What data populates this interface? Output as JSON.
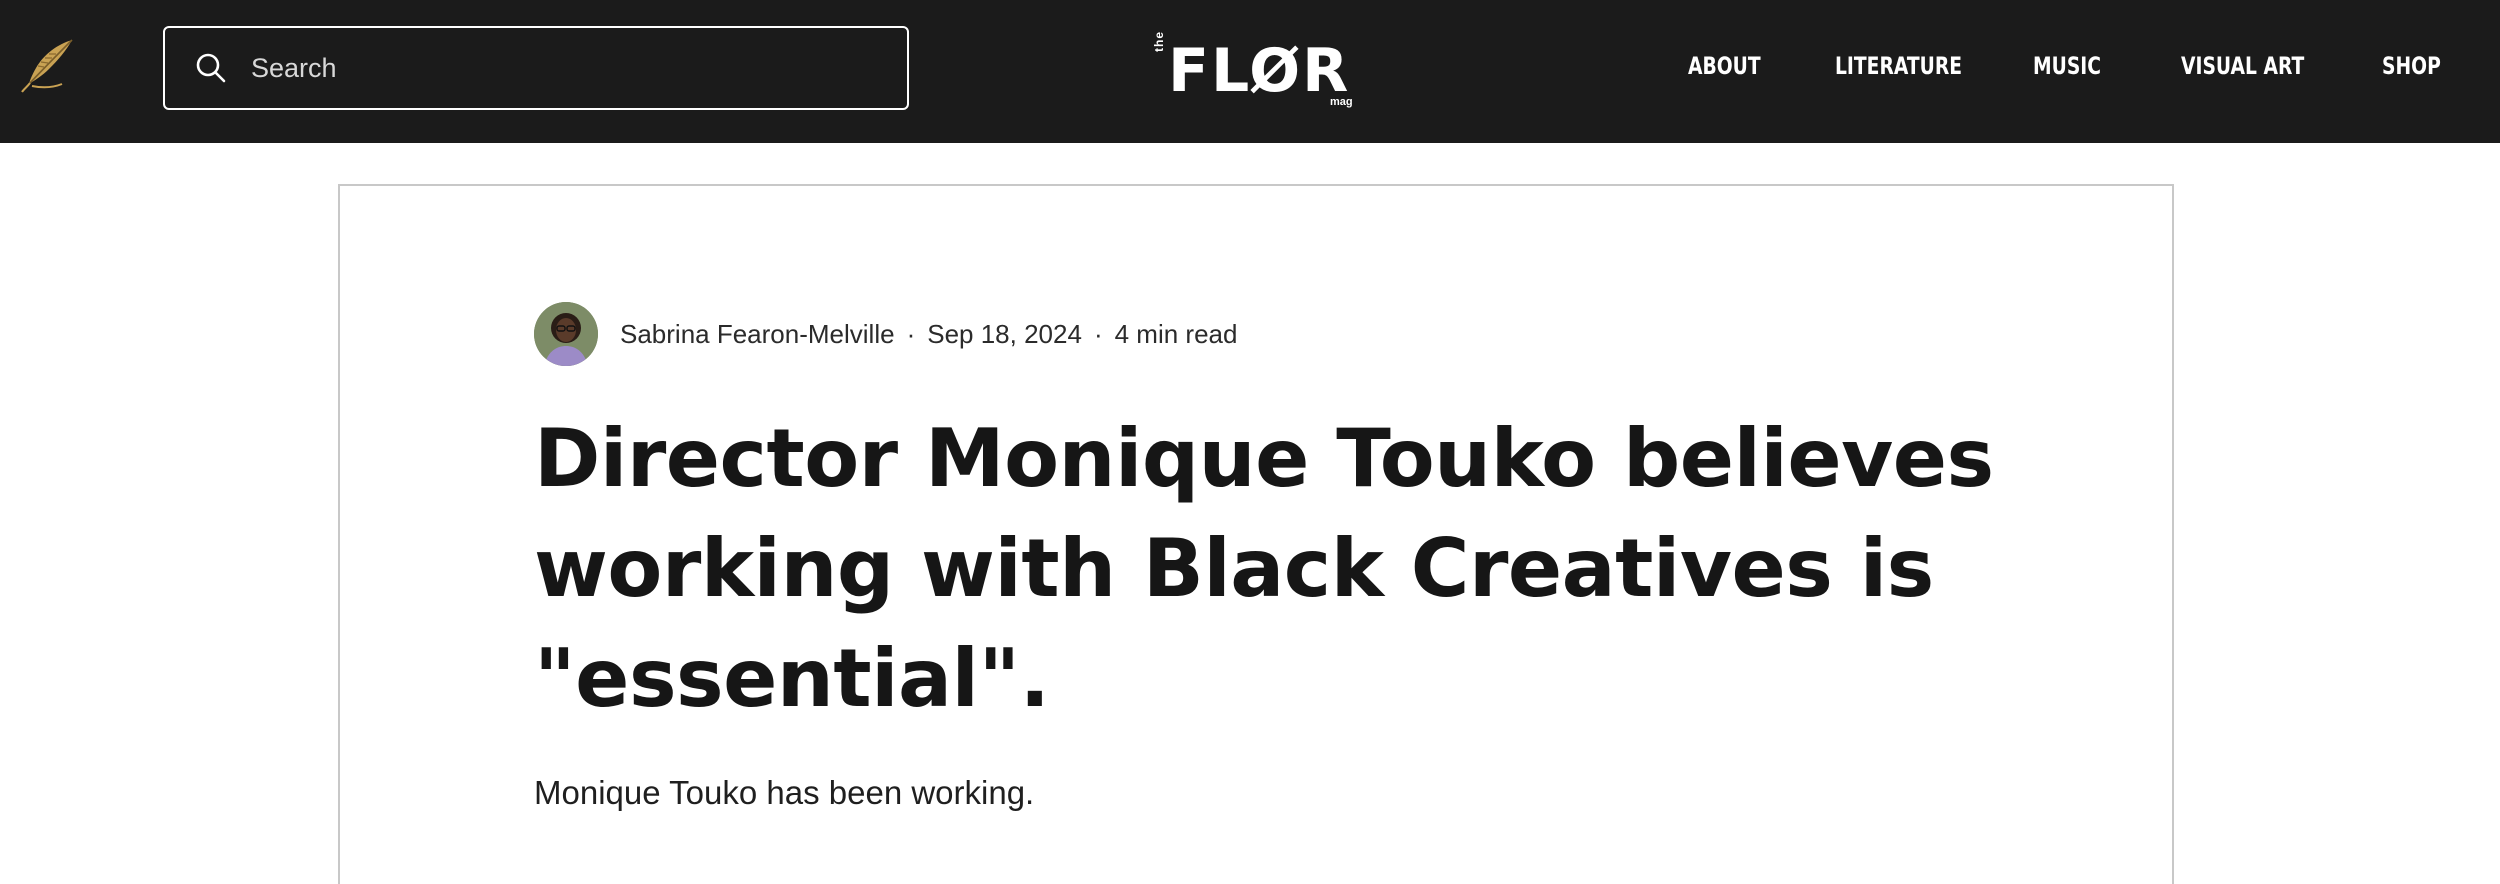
{
  "header": {
    "logo_icon": "feather-icon",
    "search": {
      "placeholder": "Search",
      "value": "",
      "icon": "search-icon"
    },
    "brand": {
      "prefix": "the",
      "word": "FLØR",
      "suffix": "mag"
    },
    "nav": [
      {
        "label": "ABOUT"
      },
      {
        "label": "LITERATURE"
      },
      {
        "label": "MUSIC"
      },
      {
        "label": "VISUAL ART"
      },
      {
        "label": "SHOP"
      }
    ]
  },
  "colors": {
    "header_bg": "#1b1b1b",
    "text": "#161616",
    "card_border": "#c8c8c8",
    "feather_gold": "#c9a253"
  },
  "post": {
    "author": "Sabrina Fearon-Melville",
    "date": "Sep 18, 2024",
    "read_time": "4 min read",
    "separator": "·",
    "title": "Director Monique Touko believes working with Black Creatives is \"essential\".",
    "lead": "Monique Touko has been working."
  }
}
